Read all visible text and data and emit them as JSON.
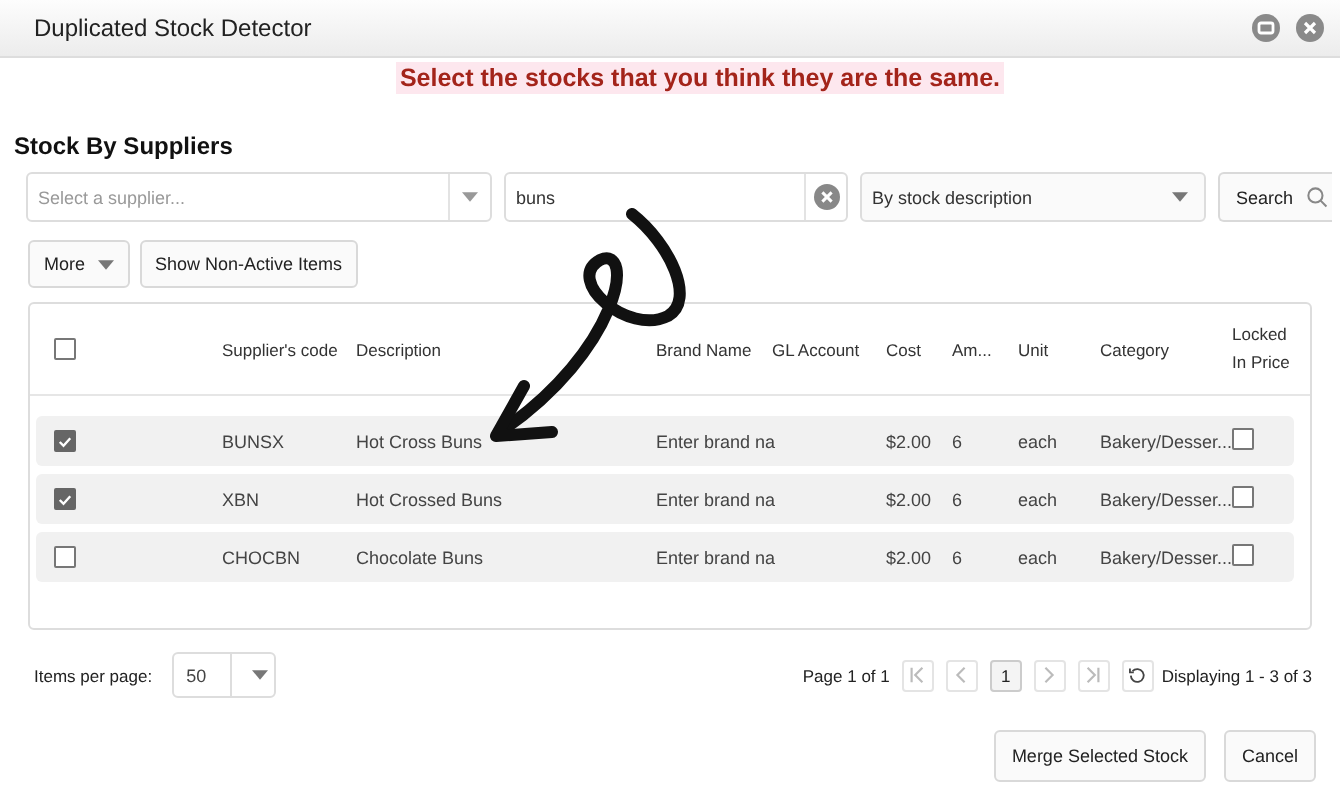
{
  "window": {
    "title": "Duplicated Stock Detector"
  },
  "annotation": "Select the stocks that you think they are the same.",
  "section_title": "Stock By Suppliers",
  "filters": {
    "supplier": {
      "placeholder": "Select a supplier..."
    },
    "search": {
      "value": "buns"
    },
    "search_by": "By stock description",
    "search_button": "Search"
  },
  "toolbar": {
    "more": "More",
    "show_inactive": "Show Non-Active Items"
  },
  "table": {
    "select_all": {
      "checked": false
    },
    "columns": [
      "Supplier's code",
      "Description",
      "Brand Name",
      "GL Account",
      "Cost",
      "Am...",
      "Unit",
      "Category",
      "Locked In Price"
    ],
    "rows": [
      {
        "selected": true,
        "code": "BUNSX",
        "description": "Hot Cross Buns",
        "brand": "Enter brand na",
        "gl_account": "",
        "cost": "$2.00",
        "amount": "6",
        "unit": "each",
        "category": "Bakery/Desser...",
        "locked": false
      },
      {
        "selected": true,
        "code": "XBN",
        "description": "Hot Crossed Buns",
        "brand": "Enter brand na",
        "gl_account": "",
        "cost": "$2.00",
        "amount": "6",
        "unit": "each",
        "category": "Bakery/Desser...",
        "locked": false
      },
      {
        "selected": false,
        "code": "CHOCBN",
        "description": "Chocolate Buns",
        "brand": "Enter brand na",
        "gl_account": "",
        "cost": "$2.00",
        "amount": "6",
        "unit": "each",
        "category": "Bakery/Desser...",
        "locked": false
      }
    ]
  },
  "pagination": {
    "items_label": "Items per page:",
    "per_page": "50",
    "page_info": "Page 1 of 1",
    "current_page": "1",
    "display": "Displaying 1 - 3 of 3"
  },
  "buttons": [
    "Merge Selected Stock",
    "Cancel"
  ]
}
